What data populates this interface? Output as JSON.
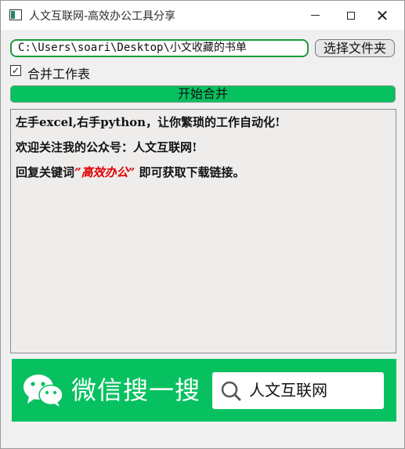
{
  "window": {
    "title": "人文互联网-高效办公工具分享",
    "minimize_label": "",
    "close_glyph": "✕"
  },
  "path_input": {
    "value": "C:\\Users\\soari\\Desktop\\小文收藏的书单"
  },
  "choose_folder_button": {
    "label": "选择文件夹"
  },
  "merge_worksheets": {
    "checked": true,
    "check_glyph": "✓",
    "label": "合并工作表"
  },
  "start_button": {
    "label": "开始合并"
  },
  "log": {
    "line1": "左手excel,右手python，让你繁琐的工作自动化!",
    "line2": "欢迎关注我的公众号：人文互联网!",
    "line3_prefix": "回复关键词",
    "line3_keyword": "”高效办公”",
    "line3_suffix": " 即可获取下载链接。"
  },
  "banner": {
    "text": "微信搜一搜",
    "search_value": "人文互联网"
  },
  "colors": {
    "accent_green": "#07c160",
    "keyword_red": "#e00000"
  }
}
